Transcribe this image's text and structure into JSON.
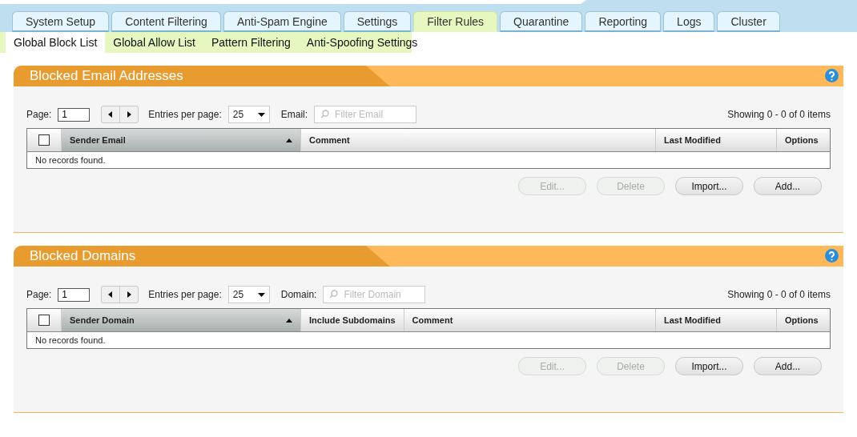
{
  "tabs": [
    {
      "label": "System Setup",
      "selected": false
    },
    {
      "label": "Content Filtering",
      "selected": false
    },
    {
      "label": "Anti-Spam Engine",
      "selected": false
    },
    {
      "label": "Settings",
      "selected": false
    },
    {
      "label": "Filter Rules",
      "selected": true
    },
    {
      "label": "Quarantine",
      "selected": false
    },
    {
      "label": "Reporting",
      "selected": false
    },
    {
      "label": "Logs",
      "selected": false
    },
    {
      "label": "Cluster",
      "selected": false
    }
  ],
  "subtabs": [
    {
      "label": "Global Block List",
      "selected": true
    },
    {
      "label": "Global Allow List",
      "selected": false
    },
    {
      "label": "Pattern Filtering",
      "selected": false
    },
    {
      "label": "Anti-Spoofing Settings",
      "selected": false
    }
  ],
  "panels": [
    {
      "title": "Blocked Email Addresses",
      "page_label": "Page:",
      "page": "1",
      "entries_label": "Entries per page:",
      "entries": "25",
      "filter_label": "Email:",
      "filter_placeholder": "Filter Email",
      "showing": "Showing 0 - 0 of 0 items",
      "select_all_checked": false,
      "columns": [
        {
          "label": "Sender Email",
          "sorted": true
        },
        {
          "label": "Comment",
          "sorted": false
        },
        {
          "label": "Last Modified",
          "sorted": false
        },
        {
          "label": "Options",
          "sorted": false
        }
      ],
      "empty_text": "No records found.",
      "buttons": [
        {
          "label": "Edit...",
          "disabled": true
        },
        {
          "label": "Delete",
          "disabled": true
        },
        {
          "label": "Import...",
          "disabled": false
        },
        {
          "label": "Add...",
          "disabled": false
        }
      ]
    },
    {
      "title": "Blocked Domains",
      "page_label": "Page:",
      "page": "1",
      "entries_label": "Entries per page:",
      "entries": "25",
      "filter_label": "Domain:",
      "filter_placeholder": "Filter Domain",
      "showing": "Showing 0 - 0 of 0 items",
      "select_all_checked": false,
      "columns": [
        {
          "label": "Sender Domain",
          "sorted": true
        },
        {
          "label": "Include Subdomains",
          "sorted": false
        },
        {
          "label": "Comment",
          "sorted": false
        },
        {
          "label": "Last Modified",
          "sorted": false
        },
        {
          "label": "Options",
          "sorted": false
        }
      ],
      "empty_text": "No records found.",
      "buttons": [
        {
          "label": "Edit...",
          "disabled": true
        },
        {
          "label": "Delete",
          "disabled": true
        },
        {
          "label": "Import...",
          "disabled": false
        },
        {
          "label": "Add...",
          "disabled": false
        }
      ]
    }
  ]
}
